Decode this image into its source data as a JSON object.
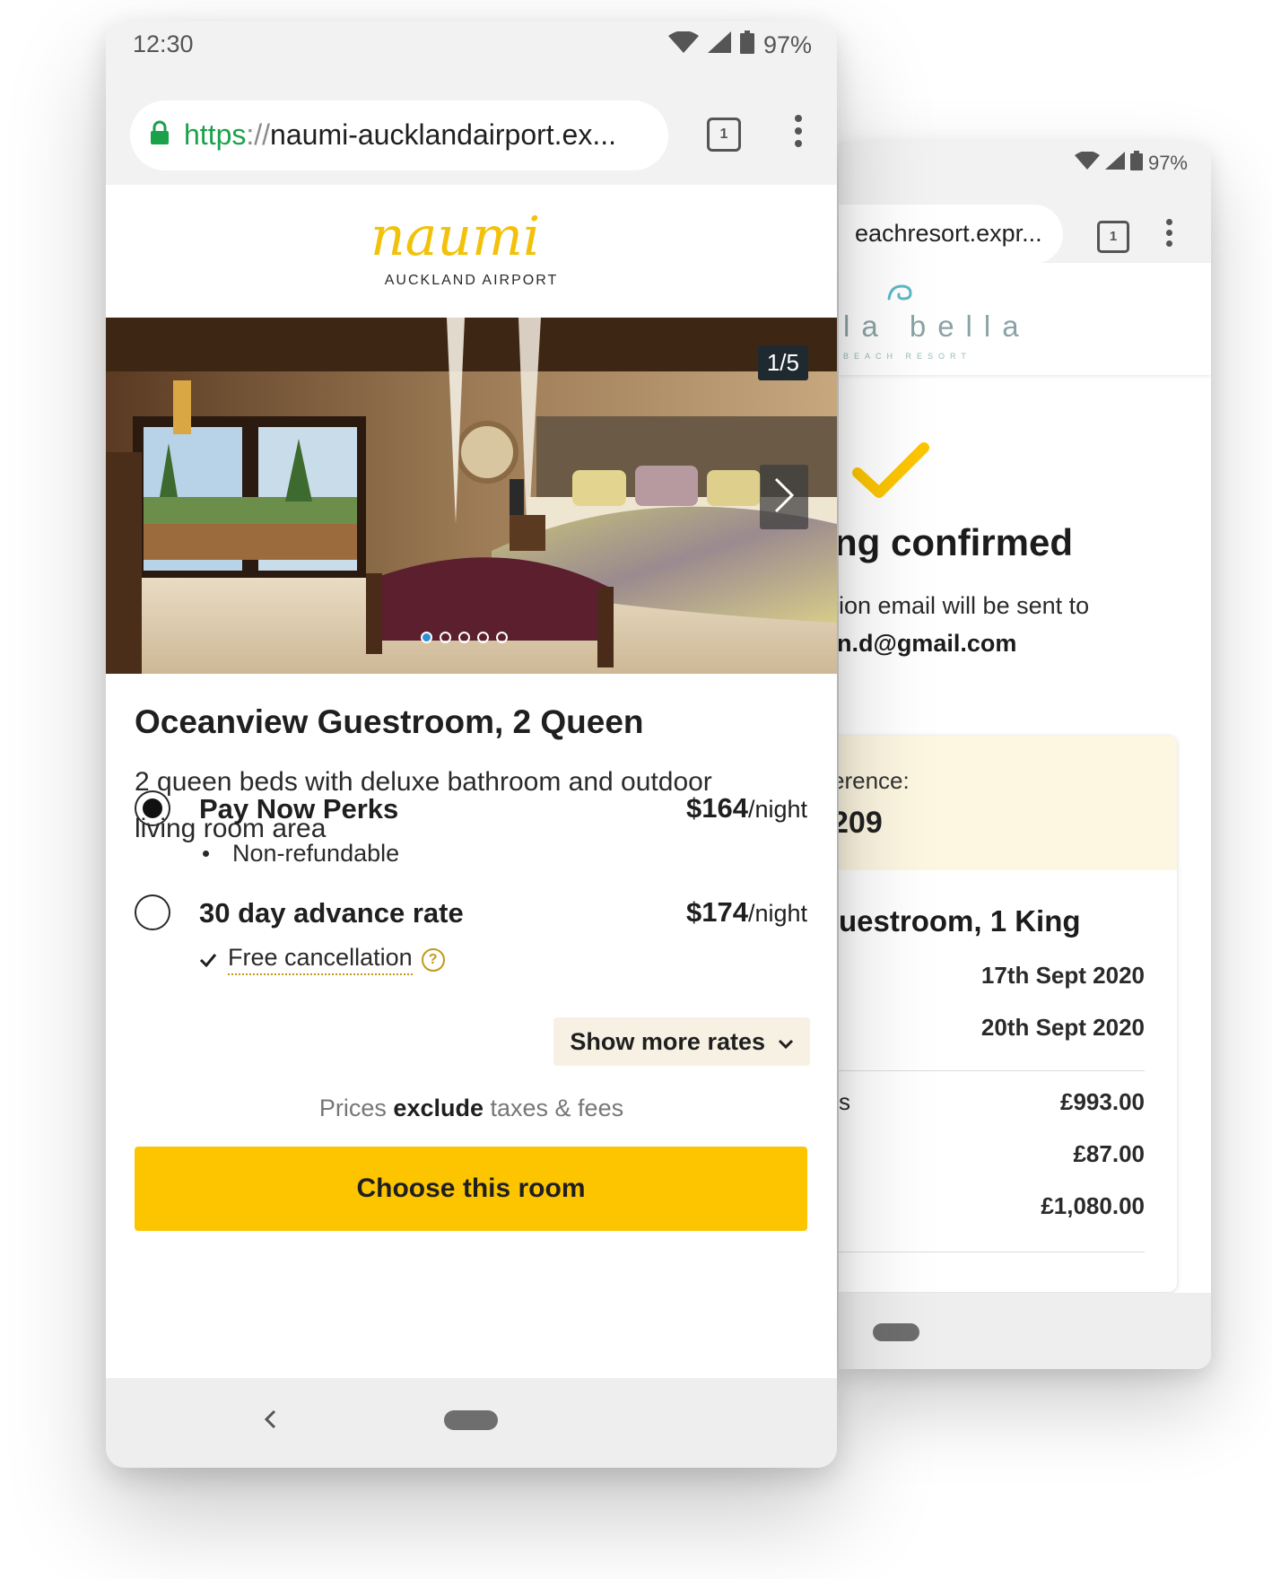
{
  "back_phone": {
    "status": {
      "battery": "97%"
    },
    "url": "eachresort.expr...",
    "tab_count": "1",
    "brand": {
      "name": "la bella",
      "sub": "BEACH RESORT"
    },
    "confirmed_title": "ng confirmed",
    "email_line": "ion email will be sent to",
    "email_address": "n.d@gmail.com",
    "reference_label": "erence:",
    "reference_value": "209",
    "room": "uestroom, 1 King",
    "date_in": "17th Sept 2020",
    "date_out": "20th Sept 2020",
    "row_label_fragment": "s",
    "price_1": "£993.00",
    "price_2": "£87.00",
    "price_3": "£1,080.00"
  },
  "front_phone": {
    "status": {
      "time": "12:30",
      "battery": "97%"
    },
    "url": {
      "scheme": "https",
      "sep": "://",
      "host": "naumi-aucklandairport.ex..."
    },
    "tab_count": "1",
    "logo": {
      "name": "naumi",
      "sub": "AUCKLAND AIRPORT"
    },
    "photo": {
      "counter": "1/5",
      "slide_count": 5,
      "active_slide": 1
    },
    "room_title": "Oceanview Guestroom, 2 Queen",
    "room_description": "2 queen beds with deluxe bathroom and outdoor living room area",
    "rates": [
      {
        "name": "Pay Now Perks",
        "price": "$164",
        "per": "/night",
        "note": "Non-refundable",
        "selected": true
      },
      {
        "name": "30 day advance rate",
        "price": "$174",
        "per": "/night",
        "note": "Free cancellation",
        "selected": false
      }
    ],
    "help_glyph": "?",
    "show_more_label": "Show more rates",
    "prices_note": {
      "prefix": "Prices",
      "bold": "exclude",
      "suffix": "taxes & fees"
    },
    "cta_label": "Choose this room"
  },
  "colors": {
    "accent": "#fdc500",
    "url_green": "#1aa24b",
    "logo_gold": "#f2c20a",
    "ref_bg": "#fdf6e1"
  }
}
